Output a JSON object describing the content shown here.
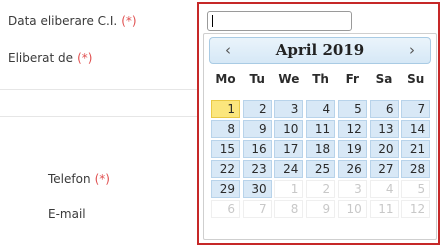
{
  "form": {
    "labels": [
      {
        "text": "Data eliberare C.I.",
        "req": "(*)"
      },
      {
        "text": "Eliberat de",
        "req": "(*)"
      },
      {
        "text": "Telefon",
        "req": "(*)"
      },
      {
        "text": "E-mail",
        "req": ""
      }
    ],
    "date_input_value": ""
  },
  "datepicker": {
    "prev_icon": "‹",
    "next_icon": "›",
    "month_title": "April 2019",
    "weekdays": [
      "Mo",
      "Tu",
      "We",
      "Th",
      "Fr",
      "Sa",
      "Su"
    ],
    "weeks": [
      [
        {
          "d": "1",
          "t": "today"
        },
        {
          "d": "2",
          "t": "cur"
        },
        {
          "d": "3",
          "t": "cur"
        },
        {
          "d": "4",
          "t": "cur"
        },
        {
          "d": "5",
          "t": "cur"
        },
        {
          "d": "6",
          "t": "cur"
        },
        {
          "d": "7",
          "t": "cur"
        }
      ],
      [
        {
          "d": "8",
          "t": "cur"
        },
        {
          "d": "9",
          "t": "cur"
        },
        {
          "d": "10",
          "t": "cur"
        },
        {
          "d": "11",
          "t": "cur"
        },
        {
          "d": "12",
          "t": "cur"
        },
        {
          "d": "13",
          "t": "cur"
        },
        {
          "d": "14",
          "t": "cur"
        }
      ],
      [
        {
          "d": "15",
          "t": "cur"
        },
        {
          "d": "16",
          "t": "cur"
        },
        {
          "d": "17",
          "t": "cur"
        },
        {
          "d": "18",
          "t": "cur"
        },
        {
          "d": "19",
          "t": "cur"
        },
        {
          "d": "20",
          "t": "cur"
        },
        {
          "d": "21",
          "t": "cur"
        }
      ],
      [
        {
          "d": "22",
          "t": "cur"
        },
        {
          "d": "23",
          "t": "cur"
        },
        {
          "d": "24",
          "t": "cur"
        },
        {
          "d": "25",
          "t": "cur"
        },
        {
          "d": "26",
          "t": "cur"
        },
        {
          "d": "27",
          "t": "cur"
        },
        {
          "d": "28",
          "t": "cur"
        }
      ],
      [
        {
          "d": "29",
          "t": "cur"
        },
        {
          "d": "30",
          "t": "cur"
        },
        {
          "d": "1",
          "t": "other"
        },
        {
          "d": "2",
          "t": "other"
        },
        {
          "d": "3",
          "t": "other"
        },
        {
          "d": "4",
          "t": "other"
        },
        {
          "d": "5",
          "t": "other"
        }
      ],
      [
        {
          "d": "6",
          "t": "other"
        },
        {
          "d": "7",
          "t": "other"
        },
        {
          "d": "8",
          "t": "other"
        },
        {
          "d": "9",
          "t": "other"
        },
        {
          "d": "10",
          "t": "other"
        },
        {
          "d": "11",
          "t": "other"
        },
        {
          "d": "12",
          "t": "other"
        }
      ]
    ]
  },
  "colors": {
    "highlight_frame": "#c62828",
    "today": "#fbe67d",
    "day_cell": "#d8e8f6",
    "required": "#e05050"
  }
}
